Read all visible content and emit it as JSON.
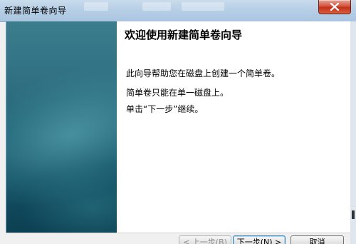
{
  "window": {
    "title": "新建简单卷向导"
  },
  "wizard": {
    "heading": "欢迎使用新建简单卷向导",
    "lines": [
      "此向导帮助您在磁盘上创建一个简单卷。",
      "简单卷只能在单一磁盘上。",
      "单击“下一步”继续。"
    ]
  },
  "buttons": {
    "back": "< 上一步(B)",
    "next": "下一步(N) >",
    "cancel": "取消"
  },
  "colors": {
    "side_panel": "#1f5f72",
    "close_button": "#c2301a"
  },
  "icons": {
    "close": "close-icon"
  }
}
